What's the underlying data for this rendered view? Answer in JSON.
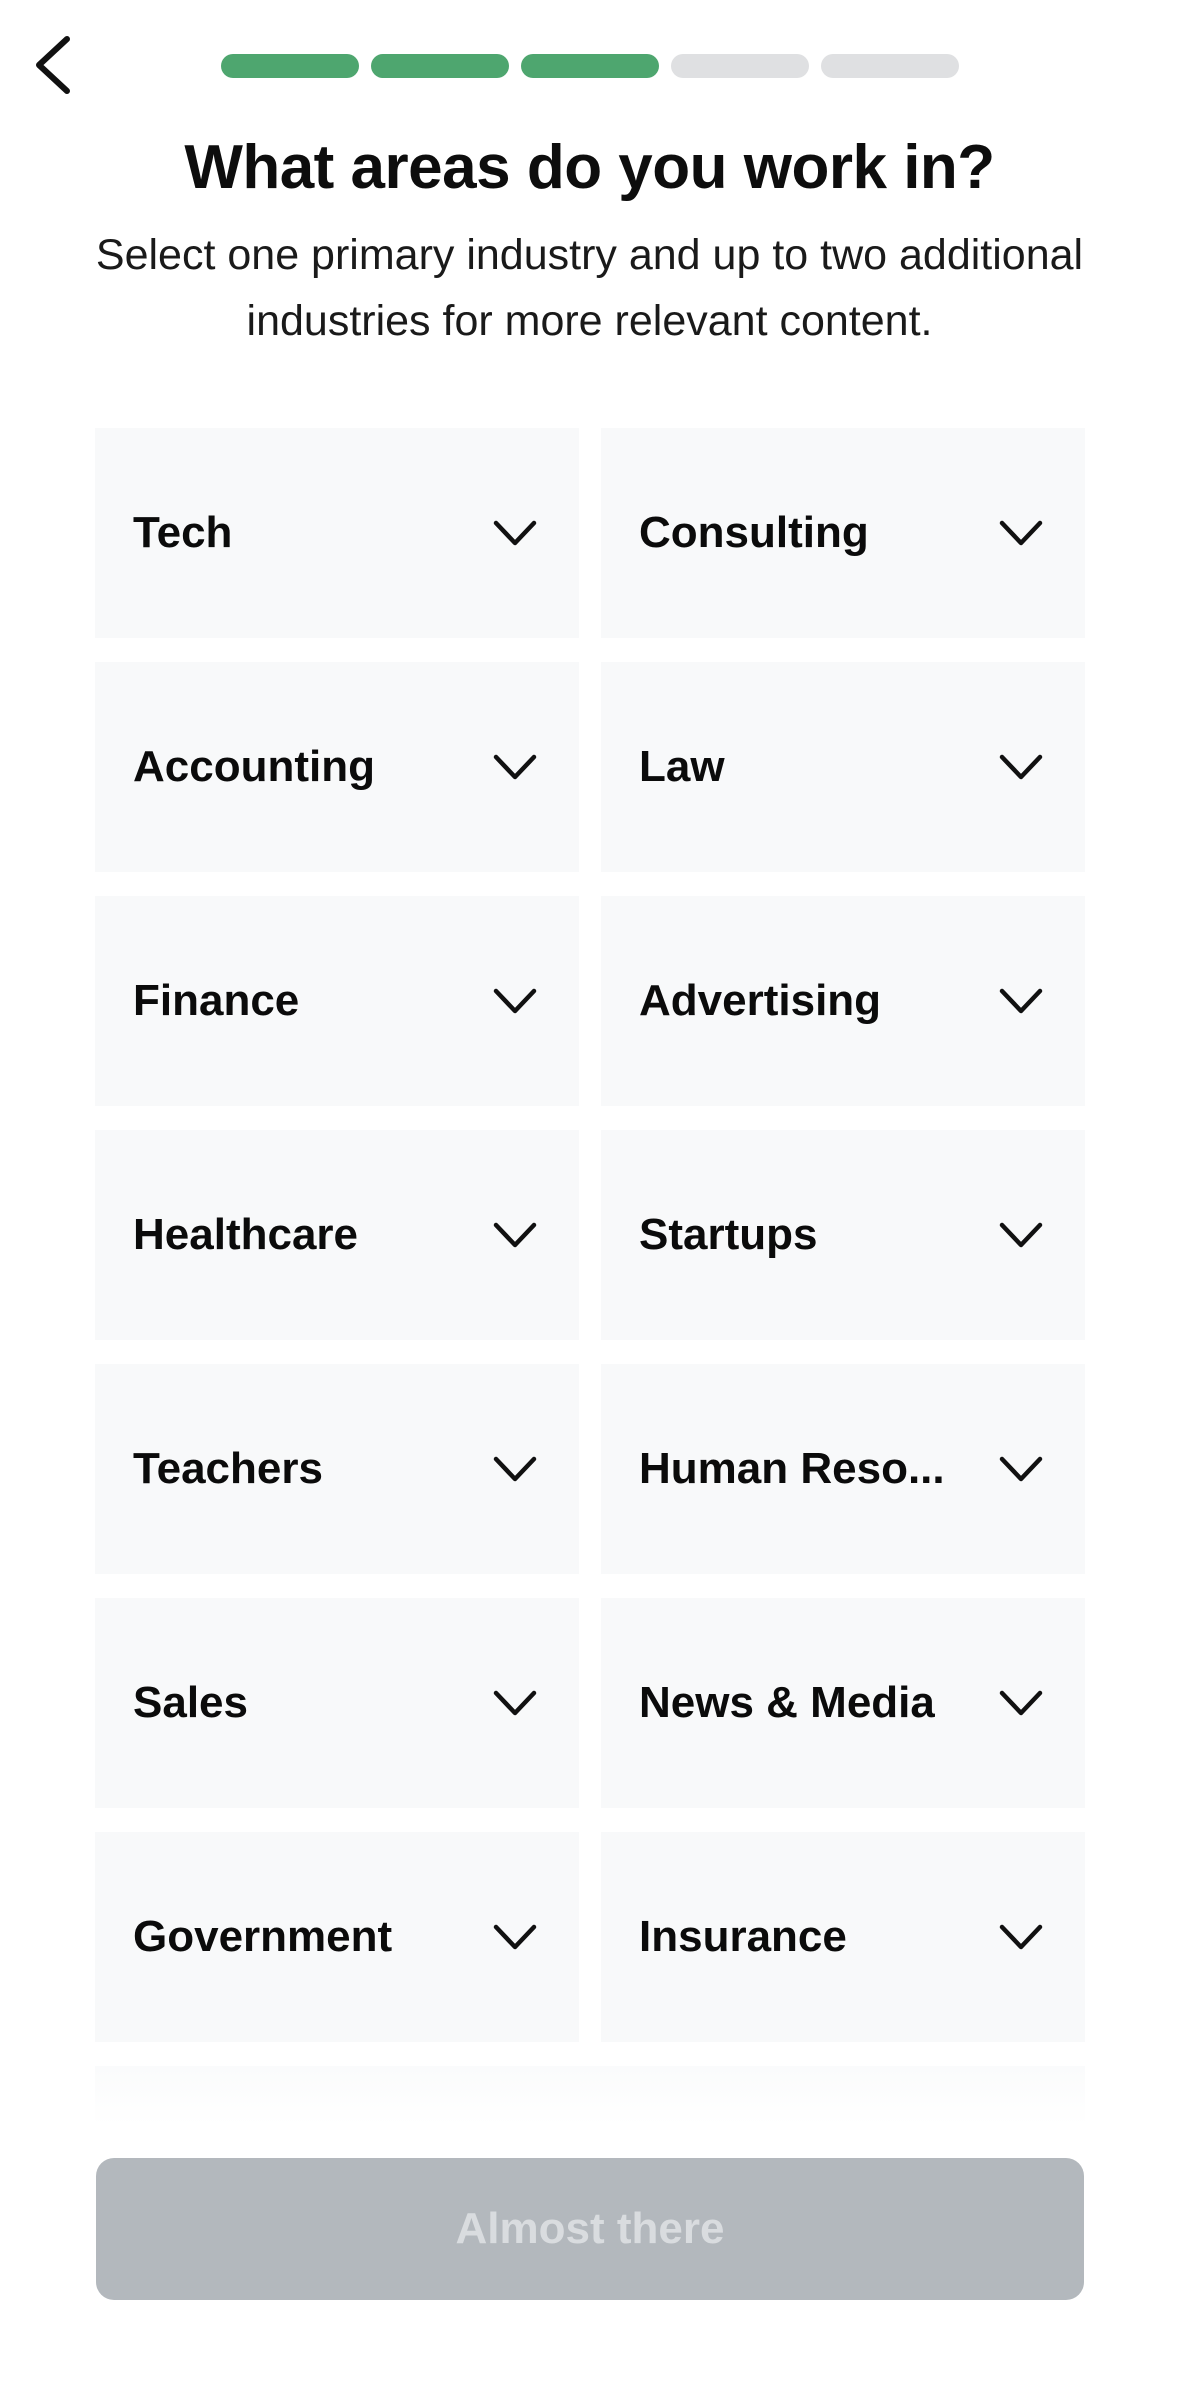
{
  "header": {
    "back_icon": "chevron-left-icon",
    "progress": {
      "total_steps": 5,
      "completed_steps": 3,
      "done_color": "#4ea66f",
      "pending_color": "#dfe0e2"
    }
  },
  "title": "What areas do you work in?",
  "subtitle": "Select one primary industry and up to two additional industries for more relevant content.",
  "industries": [
    {
      "label": "Tech"
    },
    {
      "label": "Consulting"
    },
    {
      "label": "Accounting"
    },
    {
      "label": "Law"
    },
    {
      "label": "Finance"
    },
    {
      "label": "Advertising"
    },
    {
      "label": "Healthcare"
    },
    {
      "label": "Startups"
    },
    {
      "label": "Teachers"
    },
    {
      "label": "Human Reso..."
    },
    {
      "label": "Sales"
    },
    {
      "label": "News & Media"
    },
    {
      "label": "Government"
    },
    {
      "label": "Insurance"
    }
  ],
  "cell_icon": "chevron-down-icon",
  "cta": {
    "label": "Almost there",
    "state": "disabled"
  }
}
